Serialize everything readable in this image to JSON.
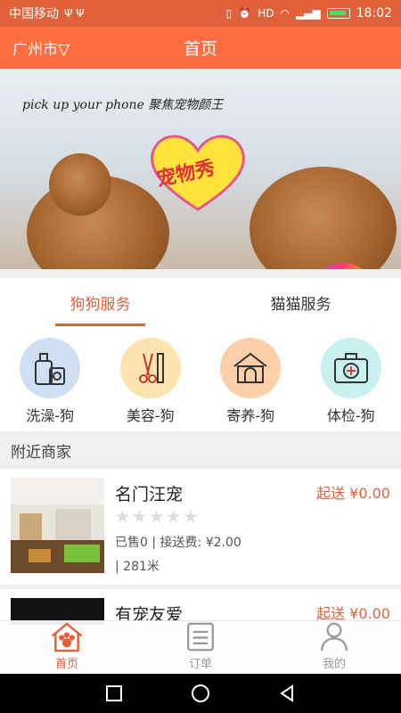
{
  "status_bar": {
    "carrier": "中国移动",
    "time": "18:02"
  },
  "header": {
    "city": "广州市▽",
    "title": "首页"
  },
  "banner": {
    "text": "pick up your phone 聚焦宠物颜王",
    "heart_text": "宠物秀"
  },
  "tabs": [
    {
      "label": "狗狗服务",
      "active": true
    },
    {
      "label": "猫猫服务",
      "active": false
    }
  ],
  "services": [
    {
      "label": "洗澡-狗",
      "icon": "shampoo-bottles-icon",
      "bg": "#cfe0f5"
    },
    {
      "label": "美容-狗",
      "icon": "scissors-comb-icon",
      "bg": "#fde3b0"
    },
    {
      "label": "寄养-狗",
      "icon": "doghouse-icon",
      "bg": "#fbd0a8"
    },
    {
      "label": "体检-狗",
      "icon": "medical-kit-icon",
      "bg": "#c8f0ee"
    }
  ],
  "nearby": {
    "title": "附近商家",
    "merchants": [
      {
        "name": "名门汪宠",
        "fee": "起送 ¥0.00",
        "rating": 0,
        "sold": "已售0",
        "delivery": "接送费: ¥2.00",
        "separator": "|",
        "distance": "281米"
      },
      {
        "name": "有宠友爱",
        "fee": "起送 ¥0.00"
      }
    ]
  },
  "tabbar": [
    {
      "label": "首页",
      "icon": "paw-house-icon",
      "active": true
    },
    {
      "label": "订单",
      "icon": "order-list-icon",
      "active": false
    },
    {
      "label": "我的",
      "icon": "user-icon",
      "active": false
    }
  ],
  "colors": {
    "accent": "#e0613a",
    "header": "#ff6e40"
  }
}
